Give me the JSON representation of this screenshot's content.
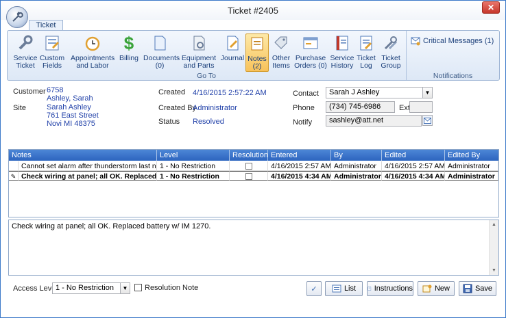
{
  "window": {
    "title": "Ticket #2405",
    "close_label": "✕"
  },
  "tab": {
    "label": "Ticket"
  },
  "ribbon": {
    "buttons": [
      {
        "line1": "Service",
        "line2": "Ticket"
      },
      {
        "line1": "Custom",
        "line2": "Fields"
      },
      {
        "line1": "Appointments",
        "line2": "and Labor"
      },
      {
        "line1": "Billing",
        "line2": ""
      },
      {
        "line1": "Documents",
        "line2": "(0)"
      },
      {
        "line1": "Equipment",
        "line2": "and Parts"
      },
      {
        "line1": "Journal",
        "line2": ""
      },
      {
        "line1": "Notes",
        "line2": "(2)"
      },
      {
        "line1": "Other",
        "line2": "Items"
      },
      {
        "line1": "Purchase",
        "line2": "Orders (0)"
      },
      {
        "line1": "Service",
        "line2": "History"
      },
      {
        "line1": "Ticket",
        "line2": "Log"
      },
      {
        "line1": "Ticket",
        "line2": "Group"
      }
    ],
    "goto_label": "Go To",
    "critical_messages": "Critical Messages (1)",
    "notifications_label": "Notifications"
  },
  "info": {
    "customer_label": "Customer",
    "customer_id": "6758",
    "customer_name": "Ashley, Sarah",
    "site_label": "Site",
    "site_name": "Sarah Ashley",
    "site_street": "761 East Street",
    "site_city": "Novi MI 48375",
    "created_label": "Created",
    "created_value": "4/16/2015 2:57:22 AM",
    "created_by_label": "Created By",
    "created_by_value": "Administrator",
    "status_label": "Status",
    "status_value": "Resolved",
    "contact_label": "Contact",
    "contact_value": "Sarah J Ashley",
    "phone_label": "Phone",
    "phone_value": "(734) 745-6986",
    "ext_label": "Ext",
    "ext_value": "",
    "notify_label": "Notify",
    "notify_value": "sashley@att.net"
  },
  "grid": {
    "columns": [
      "Notes",
      "Level",
      "Resolution",
      "Entered",
      "By",
      "Edited",
      "Edited By"
    ],
    "rows": [
      {
        "note": "Cannot set alarm after thunderstorm last night.",
        "level": "1 - No Restriction",
        "resolution": false,
        "entered": "4/16/2015 2:57 AM",
        "by": "Administrator",
        "edited": "4/16/2015 2:57 AM",
        "edited_by": "Administrator"
      },
      {
        "note": "Check wiring at panel; all OK.  Replaced battery ...",
        "level": "1 - No Restriction",
        "resolution": false,
        "entered": "4/16/2015 4:34 AM",
        "by": "Administrator",
        "edited": "4/16/2015 4:34 AM",
        "edited_by": "Administrator"
      }
    ]
  },
  "memo": {
    "text": "Check wiring at panel; all OK.  Replaced battery w/ IM 1270."
  },
  "footer": {
    "access_level_label": "Access Level",
    "access_level_value": "1 - No Restriction",
    "resolution_note_label": "Resolution Note",
    "list_label": "List",
    "instructions_label": "Instructions",
    "new_label": "New",
    "save_label": "Save"
  }
}
